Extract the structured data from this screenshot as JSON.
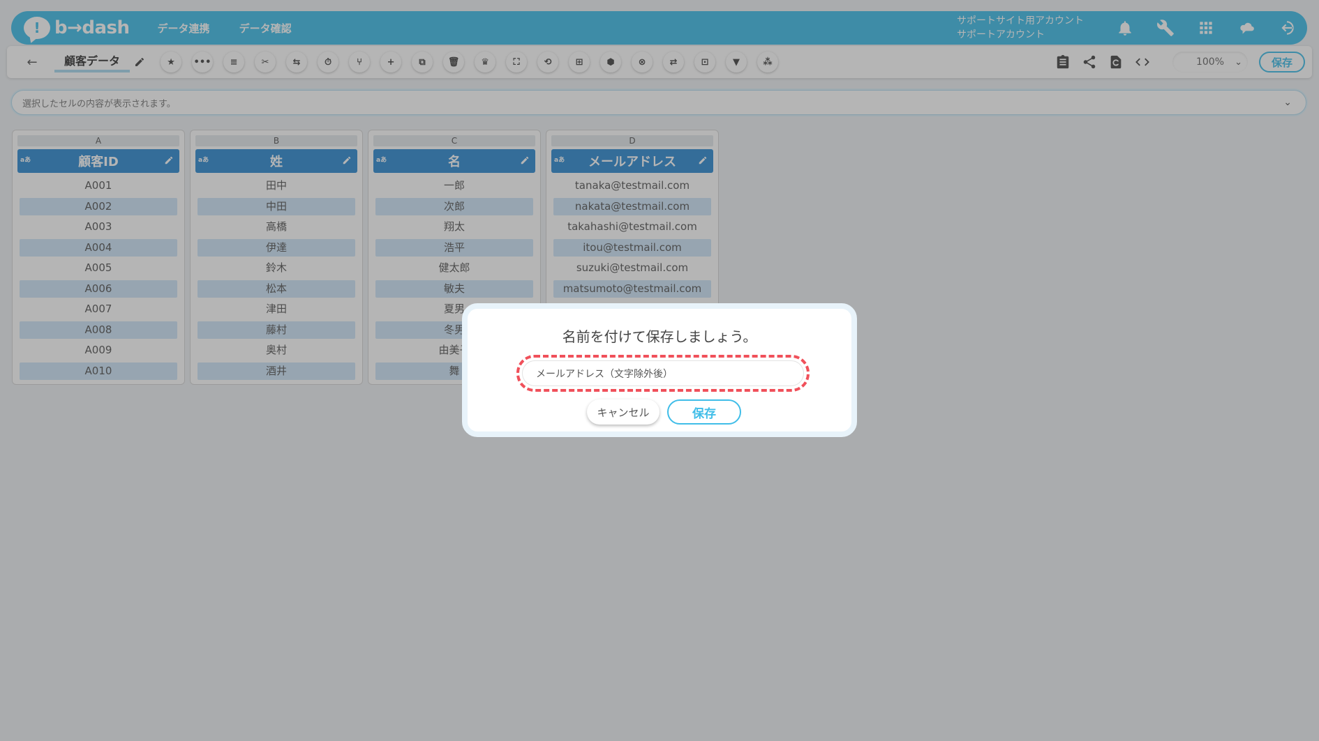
{
  "header": {
    "logo_text": "b→dash",
    "nav": [
      "データ連携",
      "データ確認"
    ],
    "account_line1": "サポートサイト用アカウント",
    "account_line2": "サポートアカウント",
    "icons": [
      "bell-icon",
      "wrench-icon",
      "apps-grid-icon",
      "cloud-chat-icon",
      "logout-icon"
    ]
  },
  "toolbar": {
    "back": "←",
    "sheet_name": "顧客データ",
    "tools": [
      "★",
      "•••",
      "≡",
      "✂",
      "⇆",
      "⏱",
      "⑂",
      "+",
      "⧉",
      "🗑",
      "♛",
      "⛶",
      "⟲",
      "⊞",
      "⬢",
      "⊗",
      "⇄",
      "⊡",
      "▼",
      "⁂"
    ],
    "zoom": "100%",
    "save_label": "保存"
  },
  "formula_bar": {
    "placeholder": "選択したセルの内容が表示されます。"
  },
  "columns": [
    {
      "letter": "A",
      "type": "aあ",
      "name": "顧客ID",
      "cells": [
        "A001",
        "A002",
        "A003",
        "A004",
        "A005",
        "A006",
        "A007",
        "A008",
        "A009",
        "A010"
      ]
    },
    {
      "letter": "B",
      "type": "aあ",
      "name": "姓",
      "cells": [
        "田中",
        "中田",
        "高橋",
        "伊達",
        "鈴木",
        "松本",
        "津田",
        "藤村",
        "奥村",
        "酒井"
      ]
    },
    {
      "letter": "C",
      "type": "aあ",
      "name": "名",
      "cells": [
        "一郎",
        "次郎",
        "翔太",
        "浩平",
        "健太郎",
        "敏夫",
        "夏男",
        "冬男",
        "由美子",
        "舞"
      ]
    },
    {
      "letter": "D",
      "type": "aあ",
      "name": "メールアドレス",
      "cells": [
        "tanaka@testmail.com",
        "nakata@testmail.com",
        "takahashi@testmail.com",
        "itou@testmail.com",
        "suzuki@testmail.com",
        "matsumoto@testmail.com"
      ]
    }
  ],
  "dialog": {
    "title": "名前を付けて保存しましょう。",
    "input_value": "メールアドレス（文字除外後）",
    "cancel_label": "キャンセル",
    "save_label": "保存"
  }
}
